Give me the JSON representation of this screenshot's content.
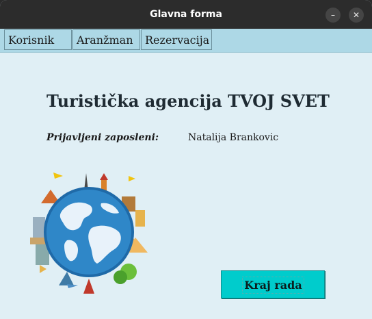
{
  "window": {
    "title": "Glavna forma"
  },
  "menu": [
    {
      "label": "Korisnik"
    },
    {
      "label": "Aranžman"
    },
    {
      "label": "Rezervacija"
    }
  ],
  "main": {
    "heading": "Turistička agencija TVOJ SVET",
    "employee_label": "Prijavljeni zaposleni:",
    "employee_name": "Natalija Brankovic",
    "exit_button": "Kraj rada"
  },
  "colors": {
    "titlebar": "#2c2c2c",
    "menubar": "#add8e6",
    "content_bg": "#e0eff5",
    "exit_button": "#00cccc"
  }
}
